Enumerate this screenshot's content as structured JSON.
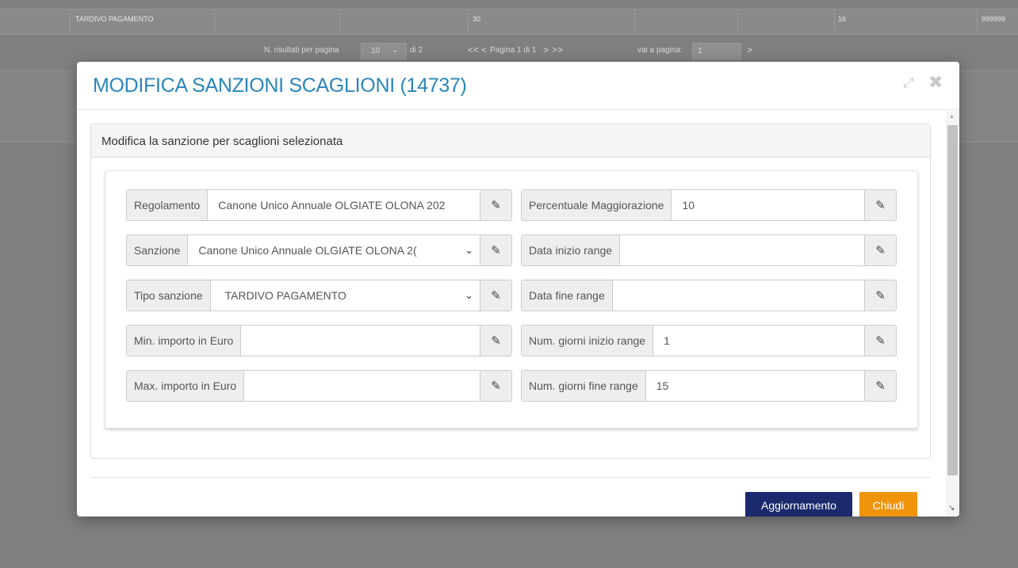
{
  "background": {
    "row": {
      "type": "TARDIVO PAGAMENTO",
      "c1": "30",
      "c2": "16",
      "c3": "999999"
    },
    "pager": {
      "per_page_label": "N. risultati per pagina",
      "per_page_value": "10",
      "of_label": "di 2",
      "nav_first": "<<",
      "nav_prev": "<",
      "page_label": "Pagina 1 di 1",
      "nav_next": ">",
      "nav_last": ">>",
      "goto_label": "vai a pagina:",
      "goto_value": "1",
      "goto_button": ">"
    }
  },
  "modal": {
    "title": "MODIFICA SANZIONI SCAGLIONI (14737)",
    "panel_heading": "Modifica la sanzione per scaglioni selezionata",
    "left_fields": [
      {
        "label": "Regolamento",
        "value": "Canone Unico Annuale OLGIATE OLONA 202",
        "type": "text"
      },
      {
        "label": "Sanzione",
        "value": "Canone Unico Annuale OLGIATE OLONA 2(",
        "type": "select"
      },
      {
        "label": "Tipo sanzione",
        "value": "TARDIVO PAGAMENTO",
        "type": "select"
      },
      {
        "label": "Min. importo in Euro",
        "value": "",
        "type": "text"
      },
      {
        "label": "Max. importo in Euro",
        "value": "",
        "type": "text"
      }
    ],
    "right_fields": [
      {
        "label": "Percentuale Maggiorazione",
        "value": "10",
        "type": "text"
      },
      {
        "label": "Data inizio range",
        "value": "",
        "type": "text"
      },
      {
        "label": "Data fine range",
        "value": "",
        "type": "text"
      },
      {
        "label": "Num. giorni inizio range",
        "value": "1",
        "type": "text"
      },
      {
        "label": "Num. giorni fine range",
        "value": "15",
        "type": "text"
      }
    ],
    "buttons": {
      "update": "Aggiornamento",
      "close": "Chiudi"
    },
    "icons": {
      "expand": "expand-icon",
      "close": "close-x-icon",
      "edit": "pencil-icon",
      "caret": "chevron-down-icon"
    }
  },
  "colors": {
    "title": "#2a86b9",
    "update_button": "#1a2a6c",
    "close_button": "#f0940c"
  }
}
